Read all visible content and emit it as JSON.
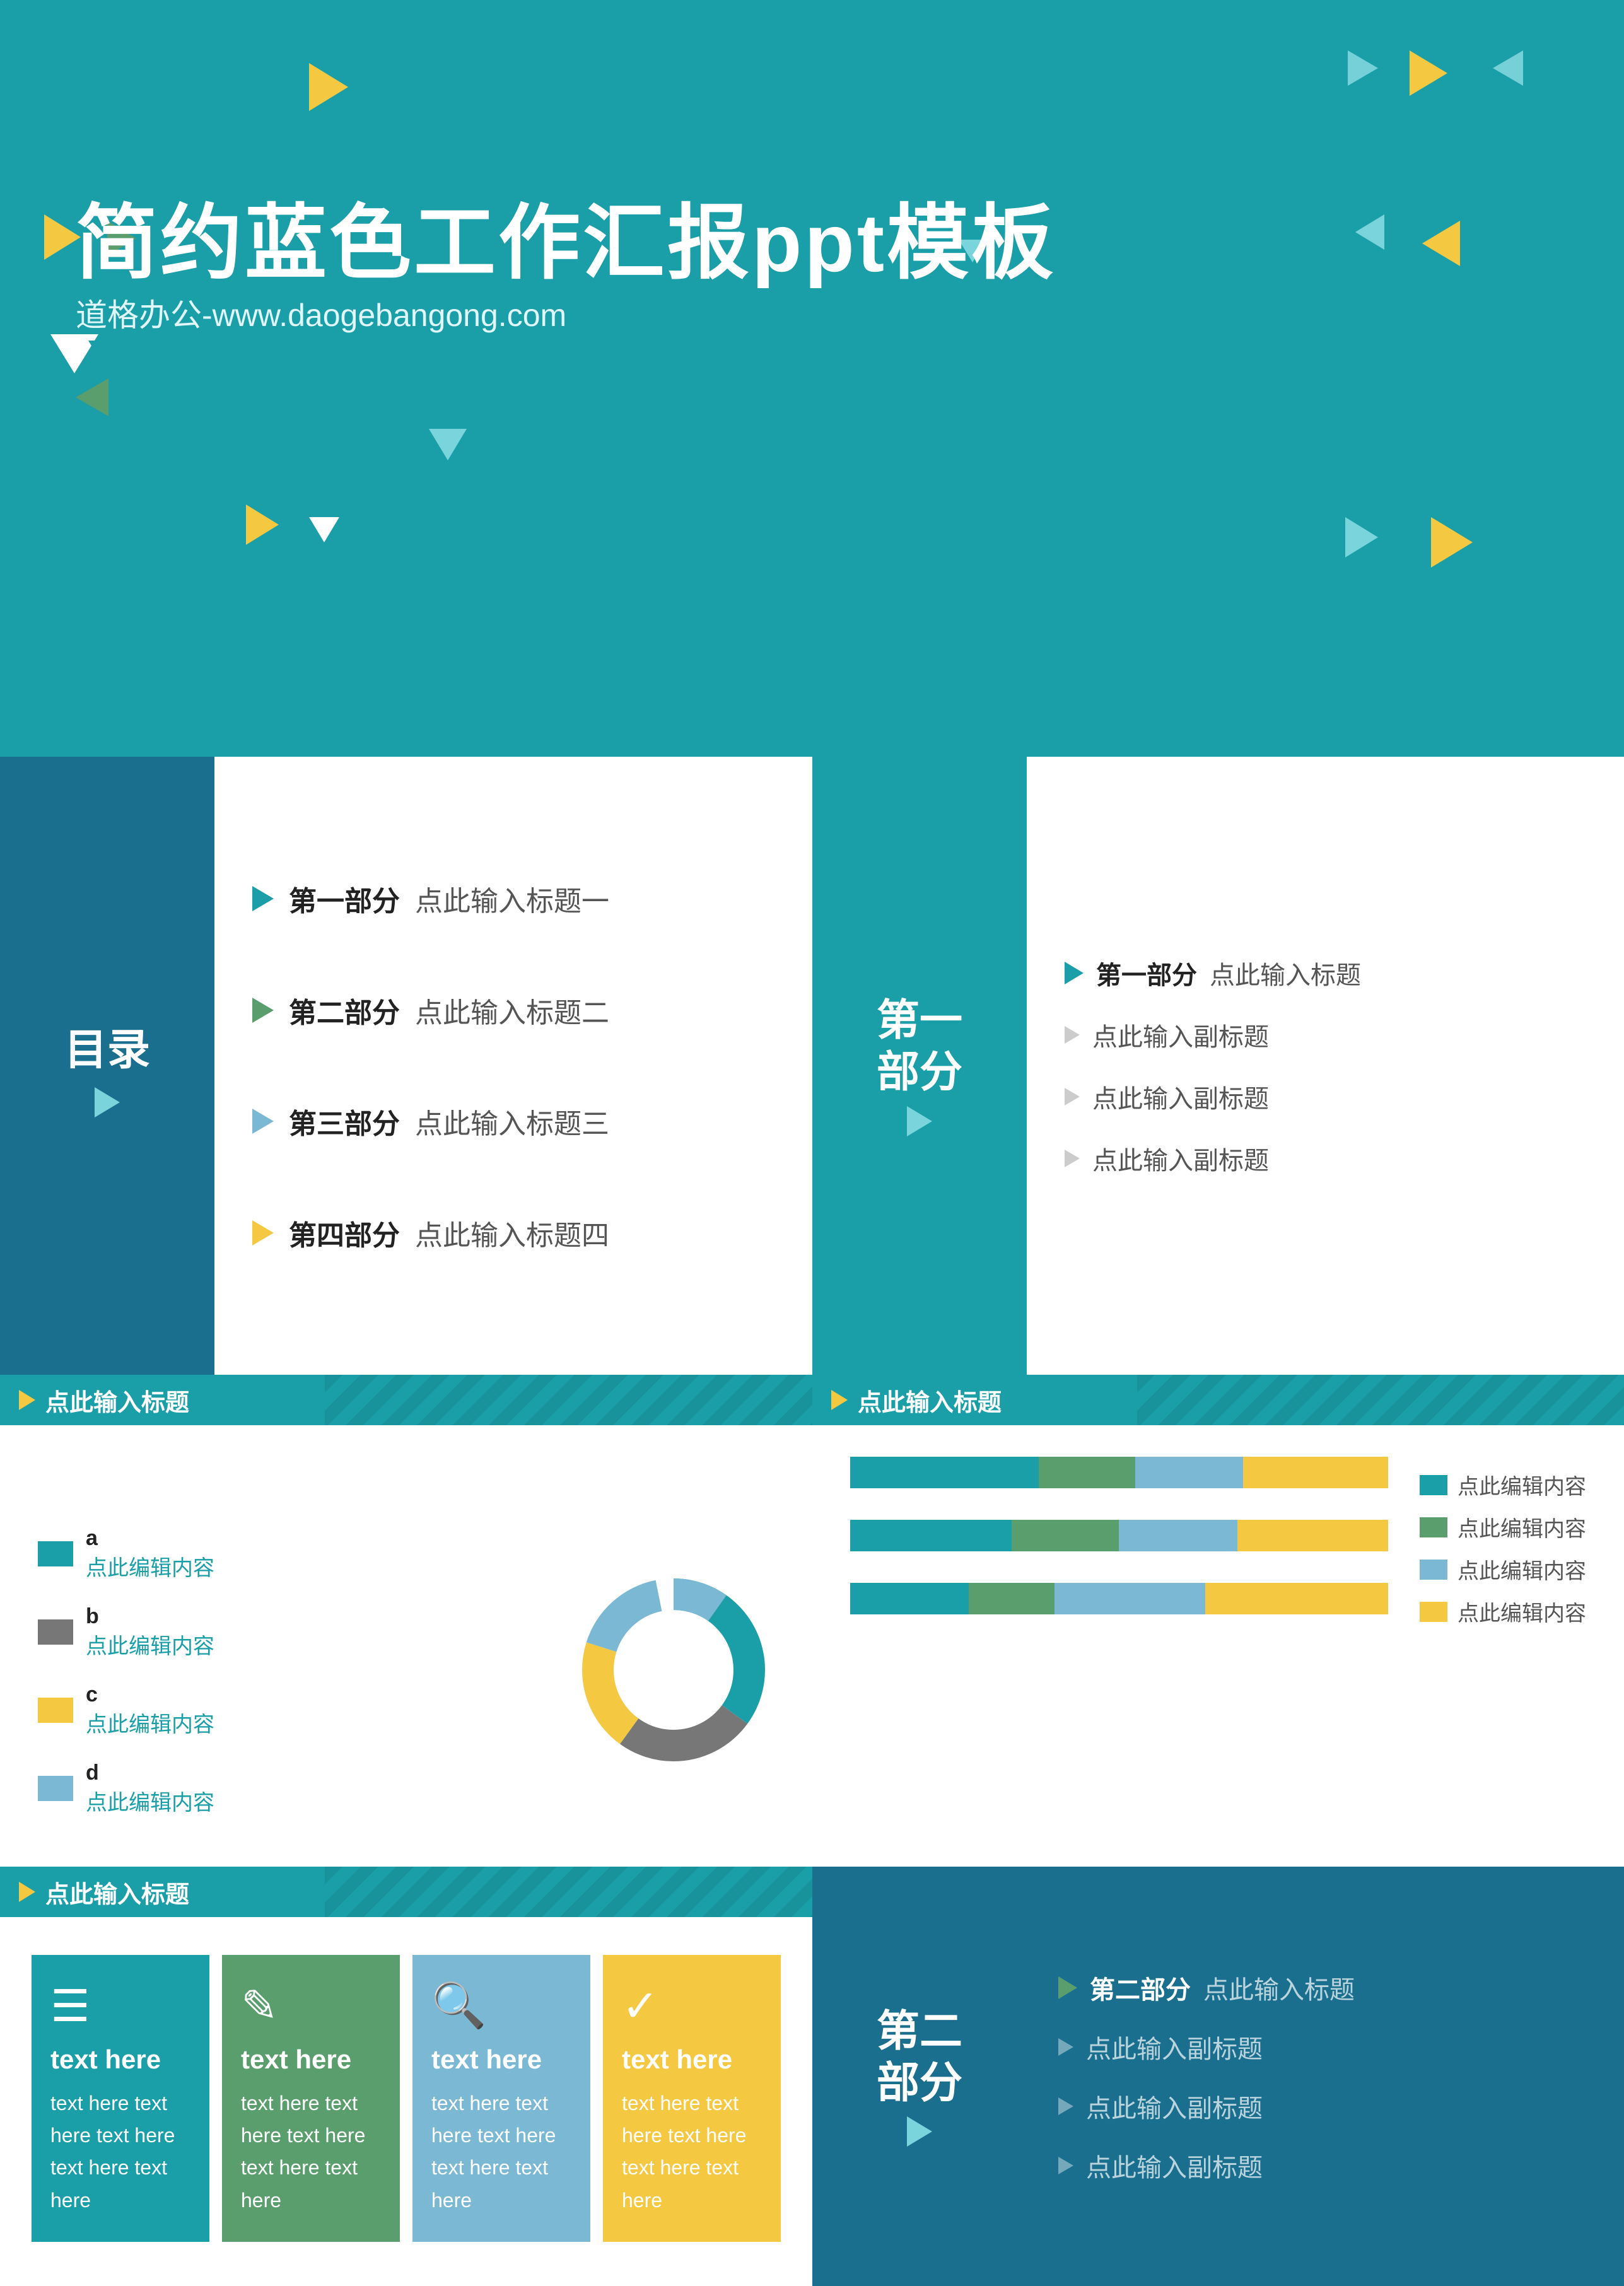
{
  "hero": {
    "title": "简约蓝色工作汇报ppt模板",
    "subtitle": "道格办公-www.daogebangong.com"
  },
  "toc": {
    "label": "目录",
    "items": [
      {
        "num": "第一部分",
        "text": "点此输入标题一",
        "color": "teal"
      },
      {
        "num": "第二部分",
        "text": "点此输入标题二",
        "color": "green"
      },
      {
        "num": "第三部分",
        "text": "点此输入标题三",
        "color": "blue"
      },
      {
        "num": "第四部分",
        "text": "点此输入标题四",
        "color": "yellow"
      }
    ]
  },
  "section1": {
    "label": "第一\n部分",
    "main_item": {
      "num": "第一部分",
      "text": "点此输入标题"
    },
    "sub_items": [
      "点此输入副标题",
      "点此输入副标题",
      "点此输入副标题"
    ]
  },
  "chart_left_header": "点此输入标题",
  "chart_right_header": "点此输入标题",
  "legend": {
    "a": {
      "label": "a",
      "content": "点此编辑内容"
    },
    "b": {
      "label": "b",
      "content": "点此编辑内容"
    },
    "c": {
      "label": "c",
      "content": "点此编辑内容"
    },
    "d": {
      "label": "d",
      "content": "点此编辑内容"
    }
  },
  "bar_legend": {
    "items": [
      {
        "color": "#1a9ea8",
        "text": "点此编辑内容"
      },
      {
        "color": "#5b9e6e",
        "text": "点此编辑内容"
      },
      {
        "color": "#7ab8d4",
        "text": "点此编辑内容"
      },
      {
        "color": "#f5c842",
        "text": "点此编辑内容"
      }
    ]
  },
  "slide3_header": "点此输入标题",
  "icon_boxes": [
    {
      "icon": "☰",
      "title": "text here",
      "text": "text here text\nhere text here\ntext here text\nhere",
      "color_class": "ib-teal"
    },
    {
      "icon": "✎",
      "title": "text here",
      "text": "text here text\nhere text here\ntext here text\nhere",
      "color_class": "ib-green"
    },
    {
      "icon": "🔍",
      "title": "text here",
      "text": "text here text\nhere text here\ntext here text\nhere",
      "color_class": "ib-blue"
    },
    {
      "icon": "✓",
      "title": "text here",
      "text": "text here text\nhere text here\ntext here text\nhere",
      "color_class": "ib-yellow"
    }
  ],
  "section2": {
    "label": "第二\n部分",
    "main_item": {
      "num": "第二部分",
      "text": "点此输入标题"
    },
    "sub_items": [
      "点此输入副标题",
      "点此输入副标题",
      "点此输入副标题"
    ]
  },
  "colors": {
    "teal": "#1a9ea8",
    "dark_teal": "#1a6e8e",
    "green": "#5b9e6e",
    "yellow": "#f5c842",
    "blue": "#7ab8d4"
  }
}
